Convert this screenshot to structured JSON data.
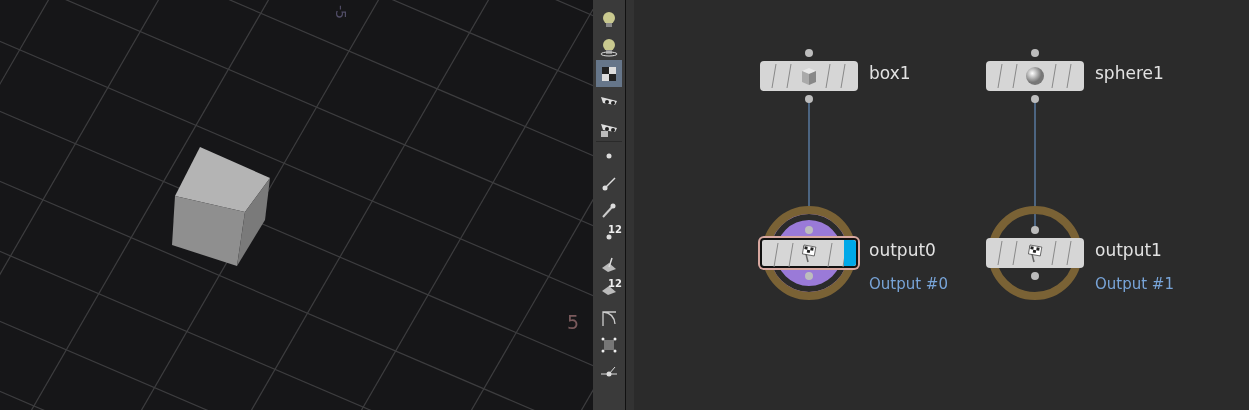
{
  "viewport": {
    "axis_labels": [
      {
        "text": "-5",
        "kind": "far"
      },
      {
        "text": "5",
        "kind": "near"
      }
    ]
  },
  "toolbar": {
    "items": [
      {
        "kind": "bulb",
        "selected": false
      },
      {
        "kind": "bulb-ring",
        "selected": false
      },
      {
        "kind": "cube-check",
        "selected": true
      },
      {
        "kind": "glasses",
        "selected": false
      },
      {
        "kind": "glasses-play",
        "selected": false
      },
      {
        "kind": "point",
        "selected": false
      },
      {
        "kind": "point-arrow",
        "selected": false
      },
      {
        "kind": "brush",
        "selected": false
      },
      {
        "kind": "point-count",
        "label": "12",
        "selected": false
      },
      {
        "kind": "prim",
        "selected": false
      },
      {
        "kind": "prim-count",
        "label": "12",
        "selected": false
      },
      {
        "kind": "curve",
        "selected": false
      },
      {
        "kind": "bounds",
        "selected": false
      },
      {
        "kind": "pivot",
        "selected": false
      }
    ]
  },
  "network": {
    "nodes": [
      {
        "name": "box1",
        "kind": "cube",
        "selected": false,
        "current": false,
        "display_flag": false,
        "ring": false
      },
      {
        "name": "sphere1",
        "kind": "sphere",
        "selected": false,
        "current": false,
        "display_flag": false,
        "ring": false
      },
      {
        "name": "output0",
        "kind": "flag",
        "selected": true,
        "current": true,
        "display_flag": true,
        "ring": true,
        "subtitle": "Output #0"
      },
      {
        "name": "output1",
        "kind": "flag",
        "selected": false,
        "current": false,
        "display_flag": false,
        "ring": true,
        "subtitle": "Output #1"
      }
    ]
  }
}
